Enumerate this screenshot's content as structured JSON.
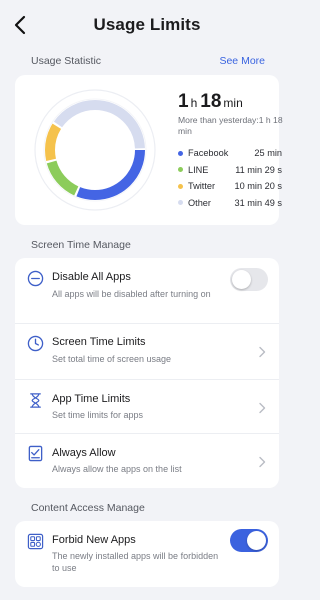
{
  "header": {
    "title": "Usage Limits"
  },
  "usage": {
    "section_label": "Usage Statistic",
    "see_more": "See More",
    "total_hours": "1",
    "hours_unit": "h",
    "total_minutes": "18",
    "minutes_unit": "min",
    "compare_text": "More than yesterday:1 h 18 min",
    "apps": [
      {
        "name": "Facebook",
        "time": "25 min",
        "color": "#4465e4",
        "minutes": 25
      },
      {
        "name": "LINE",
        "time": "11 min 29 s",
        "color": "#8ccc5b",
        "minutes": 11.48
      },
      {
        "name": "Twitter",
        "time": "10 min 20 s",
        "color": "#f5c24c",
        "minutes": 10.33
      },
      {
        "name": "Other",
        "time": "31 min 49 s",
        "color": "#d6dcef",
        "minutes": 31.82
      }
    ]
  },
  "screen_time": {
    "section_label": "Screen Time Manage",
    "items": [
      {
        "title": "Disable All Apps",
        "desc": "All apps will be disabled after turning on",
        "toggle": false
      },
      {
        "title": "Screen Time Limits",
        "desc": "Set total time of screen usage"
      },
      {
        "title": "App Time Limits",
        "desc": "Set time limits for apps"
      },
      {
        "title": "Always Allow",
        "desc": "Always allow the apps on the list"
      }
    ]
  },
  "content_access": {
    "section_label": "Content Access Manage",
    "items": [
      {
        "title": "Forbid New Apps",
        "desc": "The newly installed apps will be forbidden to use",
        "toggle": true
      }
    ]
  },
  "colors": {
    "accent": "#3b62df",
    "icon": "#3e5fc8",
    "background": "#f2f3f7"
  },
  "icons": {
    "back": "chevron-left-icon",
    "disable_all": "minus-circle-icon",
    "screen_time_limits": "clock-icon",
    "app_time_limits": "hourglass-icon",
    "always_allow": "checklist-icon",
    "forbid_new_apps": "apps-lock-icon",
    "row_arrow": "chevron-right-icon"
  }
}
